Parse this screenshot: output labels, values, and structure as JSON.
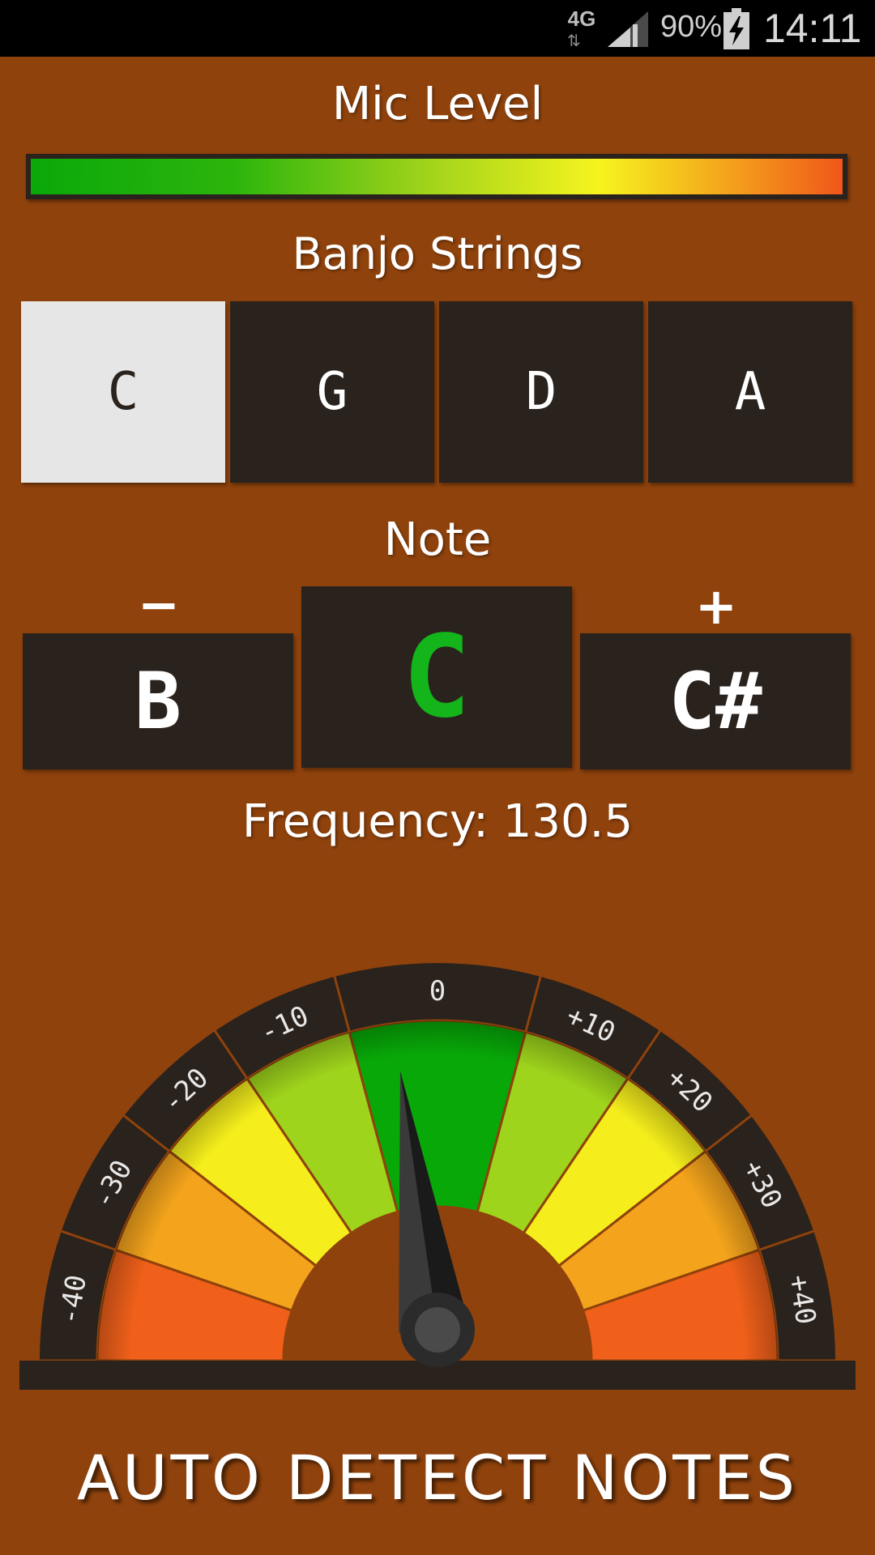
{
  "status_bar": {
    "network": "4G",
    "network_arrows": "⇅",
    "battery_percent": "90%",
    "time": "14:11"
  },
  "mic": {
    "label": "Mic Level",
    "level": 1.0
  },
  "strings": {
    "label": "Banjo Strings",
    "items": [
      {
        "label": "C",
        "selected": true
      },
      {
        "label": "G",
        "selected": false
      },
      {
        "label": "D",
        "selected": false
      },
      {
        "label": "A",
        "selected": false
      }
    ]
  },
  "note": {
    "label": "Note",
    "minus_label": "−",
    "plus_label": "+",
    "prev": "B",
    "current": "C",
    "next": "C#"
  },
  "frequency": {
    "text": "Frequency: 130.5"
  },
  "gauge": {
    "ticks": [
      "-40",
      "-30",
      "-20",
      "-10",
      "0",
      "+10",
      "+20",
      "+30",
      "+40"
    ],
    "needle_cents": -2,
    "colors": {
      "green": "#08a808",
      "lime": "#9ed41c",
      "yellow": "#f5ee1c",
      "orange": "#f4a41c",
      "red": "#f0601a"
    }
  },
  "footer": {
    "label": "AUTO DETECT NOTES"
  }
}
